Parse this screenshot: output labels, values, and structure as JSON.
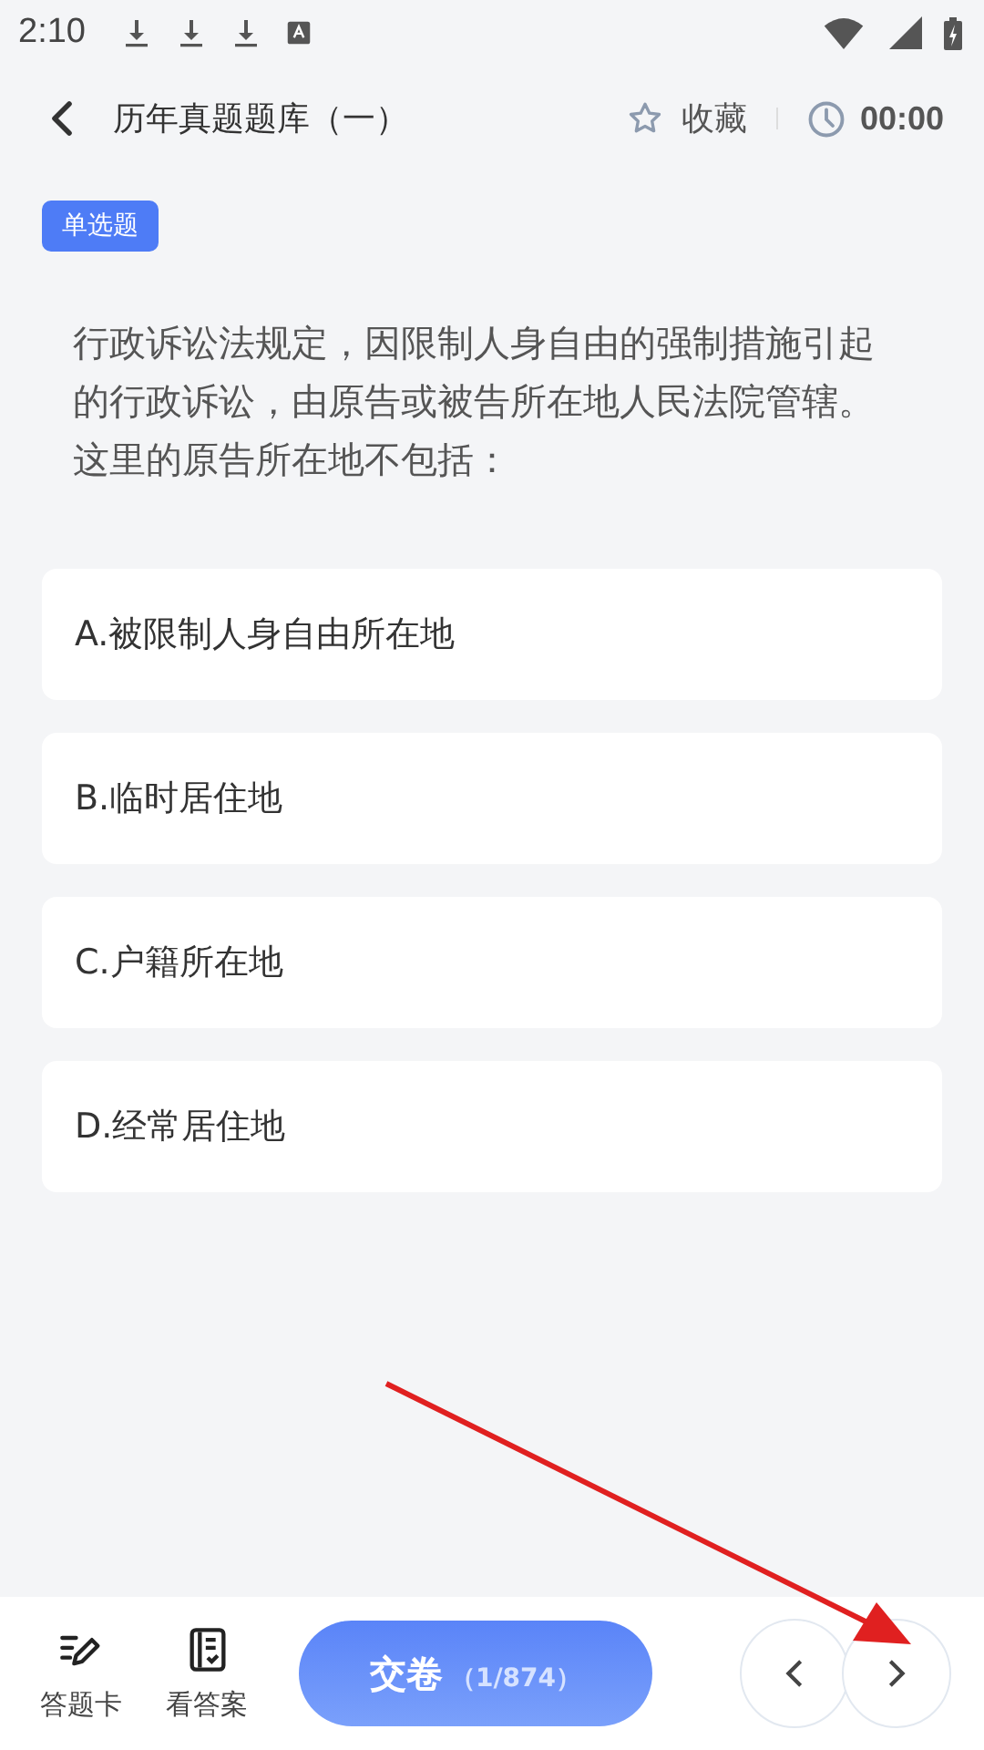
{
  "status_bar": {
    "time": "2:10"
  },
  "header": {
    "title": "历年真题题库（一）",
    "favorite_label": "收藏",
    "timer": "00:00"
  },
  "question": {
    "type_tag": "单选题",
    "text": "行政诉讼法规定，因限制人身自由的强制措施引起的行政诉讼，由原告或被告所在地人民法院管辖。这里的原告所在地不包括：",
    "options": [
      {
        "label": "A.被限制人身自由所在地",
        "selected": false
      },
      {
        "label": "B.临时居住地",
        "selected": false
      },
      {
        "label": "C.户籍所在地",
        "selected": false
      },
      {
        "label": "D.经常居住地",
        "selected": false
      }
    ]
  },
  "bottom_bar": {
    "answer_card": "答题卡",
    "view_answer": "看答案",
    "submit": "交卷",
    "progress": "（1/874）"
  }
}
